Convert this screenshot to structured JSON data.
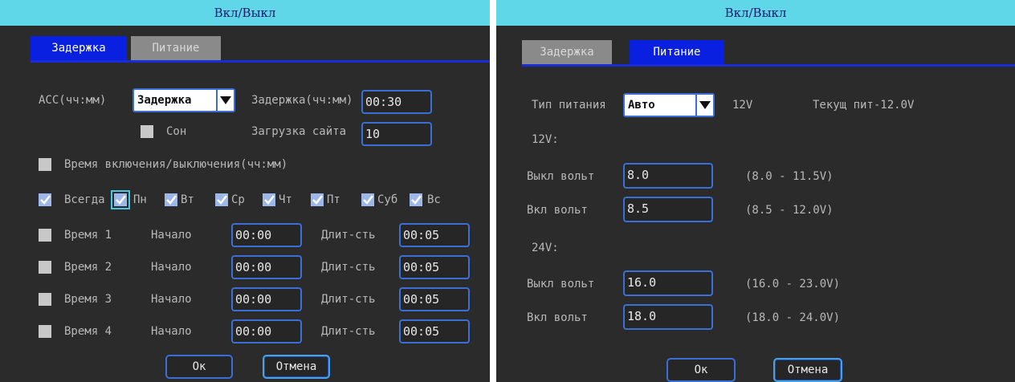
{
  "left": {
    "title": "Вкл/Выкл",
    "tabs": [
      {
        "label": "Задержка",
        "active": true
      },
      {
        "label": "Питание",
        "active": false
      }
    ],
    "acc_label": "ACC(чч:мм)",
    "acc_mode": "Задержка",
    "delay_label": "Задержка(чч:мм)",
    "delay_value": "00:30",
    "sleep_label": "Сон",
    "boot_label": "Загрузка сайта",
    "boot_value": "10",
    "onoff_label": "Время включения/выключения(чч:мм)",
    "days": [
      {
        "label": "Всегда",
        "checked": true
      },
      {
        "label": "Пн",
        "checked": true
      },
      {
        "label": "Вт",
        "checked": true
      },
      {
        "label": "Ср",
        "checked": true
      },
      {
        "label": "Чт",
        "checked": true
      },
      {
        "label": "Пт",
        "checked": true
      },
      {
        "label": "Суб",
        "checked": true
      },
      {
        "label": "Вс",
        "checked": true
      }
    ],
    "start_label": "Начало",
    "duration_label": "Длит-сть",
    "times": [
      {
        "label": "Время 1",
        "start": "00:00",
        "duration": "00:05"
      },
      {
        "label": "Время 2",
        "start": "00:00",
        "duration": "00:05"
      },
      {
        "label": "Время 3",
        "start": "00:00",
        "duration": "00:05"
      },
      {
        "label": "Время 4",
        "start": "00:00",
        "duration": "00:05"
      }
    ],
    "ok_label": "Ок",
    "cancel_label": "Отмена"
  },
  "right": {
    "title": "Вкл/Выкл",
    "tabs": [
      {
        "label": "Задержка",
        "active": false
      },
      {
        "label": "Питание",
        "active": true
      }
    ],
    "power_type_label": "Тип питания",
    "power_type_value": "Авто",
    "power_voltage": "12V",
    "current_power": "Текущ пит-12.0V",
    "section_12v": "12V:",
    "off_label": "Выкл вольт",
    "on_label": "Вкл вольт",
    "v12_off": "8.0",
    "v12_off_range": "(8.0 - 11.5V)",
    "v12_on": "8.5",
    "v12_on_range": "(8.5 - 12.0V)",
    "section_24v": "24V:",
    "v24_off": "16.0",
    "v24_off_range": "(16.0 - 23.0V)",
    "v24_on": "18.0",
    "v24_on_range": "(18.0 - 24.0V)",
    "ok_label": "Ок",
    "cancel_label": "Отмена"
  },
  "colors": {
    "title_bar": "#5fd7e9",
    "panel_bg": "#2b2b2b",
    "active_tab": "#0a20e0",
    "inactive_tab": "#8a8a8a",
    "field_border": "#3b6fd8"
  }
}
